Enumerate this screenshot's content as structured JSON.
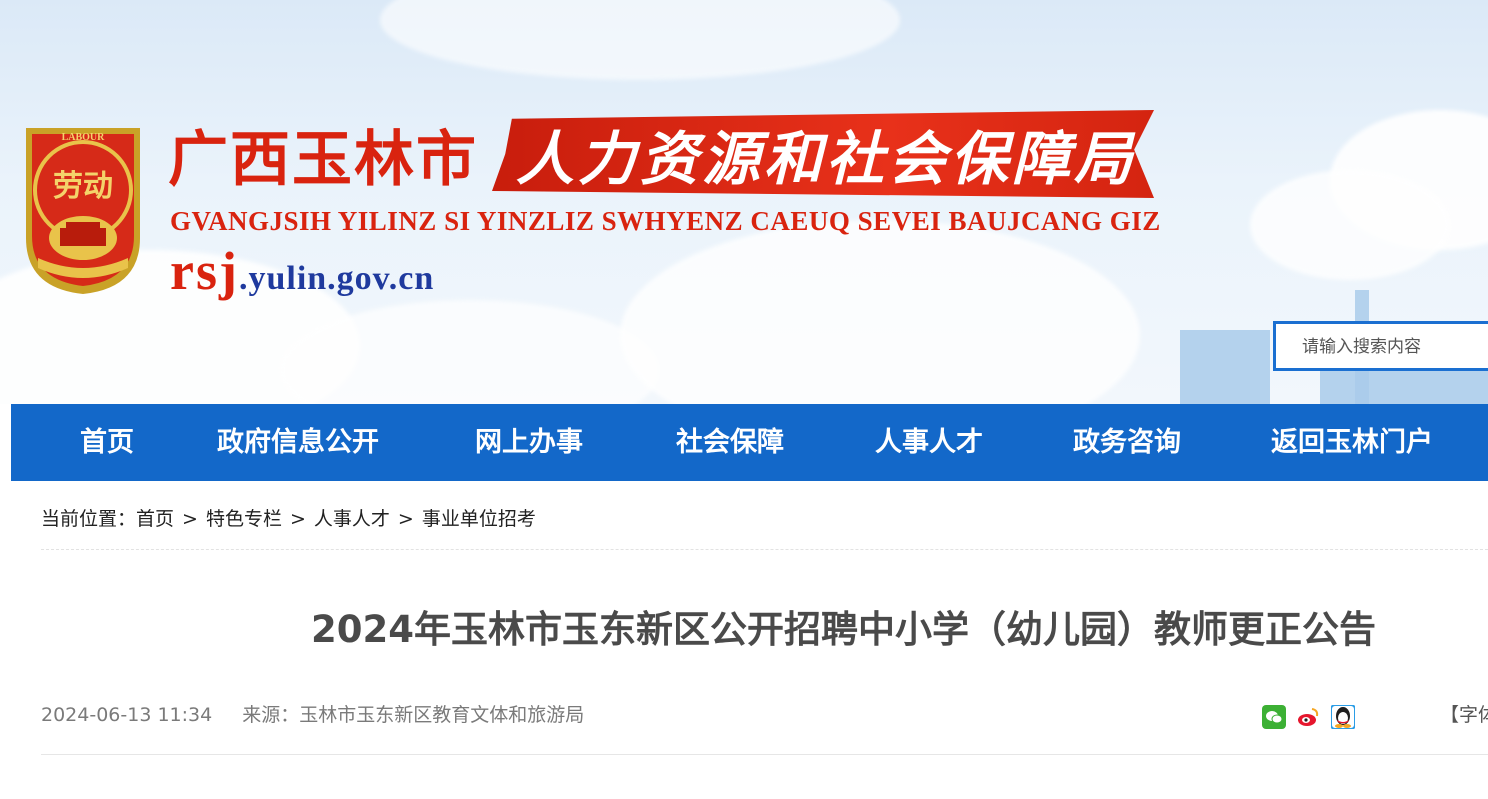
{
  "header": {
    "logo_icon": "labor-emblem-icon",
    "logo_text": "劳动",
    "logo_ring_text": "LABOUR",
    "title_cn_part1": "广西玉林市",
    "title_cn_part2": "人力资源和社会保障局",
    "title_en": "GVANGJSIH YILINZ SI YINZLIZ SWHYENZ CAEUQ SEVEI BAUJCANG GIZ",
    "domain_prefix": "rsj",
    "domain_suffix": ".yulin.gov.cn"
  },
  "search": {
    "placeholder": "请输入搜索内容"
  },
  "nav": {
    "items": [
      {
        "label": "首页"
      },
      {
        "label": "政府信息公开"
      },
      {
        "label": "网上办事"
      },
      {
        "label": "社会保障"
      },
      {
        "label": "人事人才"
      },
      {
        "label": "政务咨询"
      },
      {
        "label": "返回玉林门户"
      }
    ]
  },
  "breadcrumb": {
    "prefix": "当前位置：",
    "items": [
      "首页",
      "特色专栏",
      "人事人才",
      "事业单位招考"
    ],
    "separator": ">"
  },
  "article": {
    "title": "2024年玉林市玉东新区公开招聘中小学（幼儿园）教师更正公告",
    "date": "2024-06-13 11:34",
    "source_label": "来源：",
    "source": "玉林市玉东新区教育文体和旅游局",
    "font_size_label": "【字体"
  },
  "share": {
    "icons": [
      "wechat-icon",
      "weibo-icon",
      "qq-icon"
    ]
  },
  "colors": {
    "nav_bg": "#1368c9",
    "title_red": "#d9230f",
    "domain_blue": "#1f3a9e",
    "wechat": "#3cb034",
    "weibo": "#e6162d",
    "qq": "#2b9de6"
  }
}
